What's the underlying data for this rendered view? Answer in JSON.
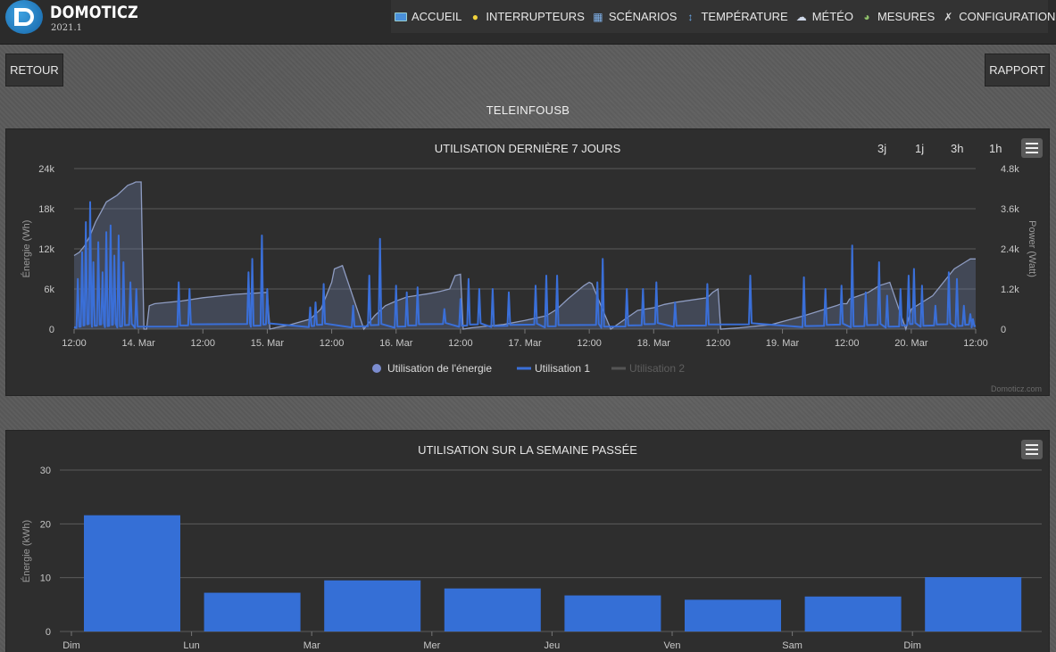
{
  "app": {
    "title": "DOMOTICZ",
    "version": "2021.1"
  },
  "nav": [
    {
      "label": "ACCUEIL",
      "icon": "dashboard-icon"
    },
    {
      "label": "INTERRUPTEURS",
      "icon": "lightbulb-icon"
    },
    {
      "label": "SCÉNARIOS",
      "icon": "clapperboard-icon"
    },
    {
      "label": "TEMPÉRATURE",
      "icon": "thermometer-icon"
    },
    {
      "label": "MÉTÉO",
      "icon": "weather-icon"
    },
    {
      "label": "MESURES",
      "icon": "gauge-icon"
    },
    {
      "label": "CONFIGURATION",
      "icon": "tools-icon"
    }
  ],
  "buttons": {
    "back": "RETOUR",
    "report": "RAPPORT"
  },
  "device": {
    "name": "TELEINFOUSB"
  },
  "colors": {
    "accent": "#3a6fd8",
    "bar": "#356fd6",
    "area": "#6e7fa6",
    "panel": "#2e2e2e"
  },
  "chart_data": [
    {
      "type": "line",
      "title": "UTILISATION DERNIÈRE 7 JOURS",
      "range_buttons": [
        "3j",
        "1j",
        "3h",
        "1h"
      ],
      "x_tick_labels": [
        "12:00",
        "14. Mar",
        "12:00",
        "15. Mar",
        "12:00",
        "16. Mar",
        "12:00",
        "17. Mar",
        "12:00",
        "18. Mar",
        "12:00",
        "19. Mar",
        "12:00",
        "20. Mar",
        "12:00"
      ],
      "y_left": {
        "label": "Énergie (Wh)",
        "ticks": [
          "0",
          "6k",
          "12k",
          "18k",
          "24k"
        ],
        "range": [
          0,
          24000
        ]
      },
      "y_right": {
        "label": "Power (Watt)",
        "ticks": [
          "0",
          "1.2k",
          "2.4k",
          "3.6k",
          "4.8k"
        ],
        "range": [
          0,
          4800
        ]
      },
      "x_range_hours": [
        0,
        168
      ],
      "series": [
        {
          "name": "Utilisation de l'énergie",
          "axis": "left",
          "style": "area",
          "x": [
            0,
            1,
            2,
            3,
            4,
            5,
            6,
            8,
            10,
            11,
            11.5,
            12,
            12.5,
            13,
            13.5,
            14,
            15,
            20,
            24,
            30,
            36,
            36.5,
            38,
            40,
            44,
            46,
            47,
            48,
            48.5,
            50,
            54,
            56,
            58,
            60,
            62,
            66,
            68,
            70,
            71,
            72,
            72.5,
            74,
            80,
            84,
            88,
            90,
            92,
            95,
            96,
            96.5,
            100,
            105,
            108,
            110,
            112,
            118,
            119,
            120,
            120.5,
            124,
            130,
            136,
            140,
            142,
            143,
            144,
            144.5,
            148,
            150,
            152,
            155,
            156,
            158,
            160,
            162,
            164,
            166,
            167,
            168
          ],
          "values": [
            11000,
            11500,
            12500,
            14000,
            16000,
            17500,
            19000,
            20000,
            21500,
            21800,
            22000,
            22000,
            22000,
            0,
            0,
            3500,
            3800,
            4200,
            4700,
            5200,
            5500,
            0,
            300,
            600,
            1500,
            3000,
            5000,
            7000,
            9000,
            9500,
            0,
            2000,
            3500,
            4200,
            4800,
            5300,
            5600,
            6000,
            8000,
            8200,
            0,
            200,
            700,
            1300,
            2000,
            3000,
            4500,
            6500,
            7000,
            6800,
            0,
            2800,
            3200,
            3700,
            4000,
            4700,
            5500,
            6000,
            0,
            200,
            700,
            2000,
            3000,
            3500,
            3800,
            3800,
            4500,
            5500,
            6500,
            7000,
            0,
            3000,
            4000,
            5000,
            7000,
            9000,
            10000,
            10500,
            10500
          ]
        },
        {
          "name": "Utilisation 1",
          "axis": "right",
          "style": "line",
          "peaks": [
            [
              0.7,
              1500
            ],
            [
              1.5,
              2300
            ],
            [
              2.2,
              3200
            ],
            [
              3.0,
              3800
            ],
            [
              3.6,
              2000
            ],
            [
              4.5,
              2600
            ],
            [
              5.3,
              1700
            ],
            [
              6.0,
              2900
            ],
            [
              6.8,
              3100
            ],
            [
              7.5,
              2200
            ],
            [
              8.3,
              2800
            ],
            [
              9.2,
              2000
            ],
            [
              10.5,
              1400
            ],
            [
              11.6,
              1200
            ],
            [
              19.5,
              1400
            ],
            [
              21.5,
              1200
            ],
            [
              32.5,
              1700
            ],
            [
              33.2,
              2100
            ],
            [
              35.0,
              2800
            ],
            [
              36.0,
              1200
            ],
            [
              44.0,
              650
            ],
            [
              45.0,
              800
            ],
            [
              46.5,
              1350
            ],
            [
              52.0,
              700
            ],
            [
              55.0,
              1600
            ],
            [
              57.0,
              2700
            ],
            [
              60.0,
              1300
            ],
            [
              62.0,
              1100
            ],
            [
              64.0,
              1250
            ],
            [
              69.0,
              600
            ],
            [
              72.0,
              900
            ],
            [
              73.5,
              1500
            ],
            [
              75.5,
              1200
            ],
            [
              78.0,
              1200
            ],
            [
              81.0,
              1100
            ],
            [
              86.0,
              1300
            ],
            [
              88.0,
              1600
            ],
            [
              90.0,
              1600
            ],
            [
              97.5,
              1400
            ],
            [
              98.5,
              2100
            ],
            [
              103.0,
              1200
            ],
            [
              106.0,
              1200
            ],
            [
              108.5,
              1400
            ],
            [
              112.0,
              800
            ],
            [
              118.0,
              1350
            ],
            [
              126.0,
              1600
            ],
            [
              136.0,
              1550
            ],
            [
              140.0,
              1200
            ],
            [
              143.0,
              1300
            ],
            [
              145.0,
              2500
            ],
            [
              147.5,
              1100
            ],
            [
              150.0,
              2000
            ],
            [
              151.5,
              1000
            ],
            [
              154.0,
              1200
            ],
            [
              155.5,
              1600
            ],
            [
              156.5,
              1800
            ],
            [
              158.0,
              1300
            ],
            [
              160.5,
              700
            ],
            [
              163.0,
              1700
            ],
            [
              164.5,
              1500
            ],
            [
              165.8,
              700
            ],
            [
              167.0,
              450
            ],
            [
              167.5,
              300
            ]
          ]
        },
        {
          "name": "Utilisation 2",
          "axis": "right",
          "style": "line",
          "visible": false,
          "values": []
        }
      ],
      "legend": [
        "Utilisation de l'énergie",
        "Utilisation 1",
        "Utilisation 2"
      ],
      "credits": "Domoticz.com"
    },
    {
      "type": "bar",
      "title": "UTILISATION SUR LA SEMAINE PASSÉE",
      "categories": [
        "Dim",
        "Lun",
        "Mar",
        "Mer",
        "Jeu",
        "Ven",
        "Sam",
        "Dim"
      ],
      "values": [
        21.6,
        7.2,
        9.5,
        8.0,
        6.7,
        5.9,
        6.5,
        10.1
      ],
      "ylabel": "Énergie (kWh)",
      "y_ticks": [
        "0",
        "10",
        "20",
        "30"
      ],
      "ylim": [
        0,
        30
      ]
    }
  ]
}
